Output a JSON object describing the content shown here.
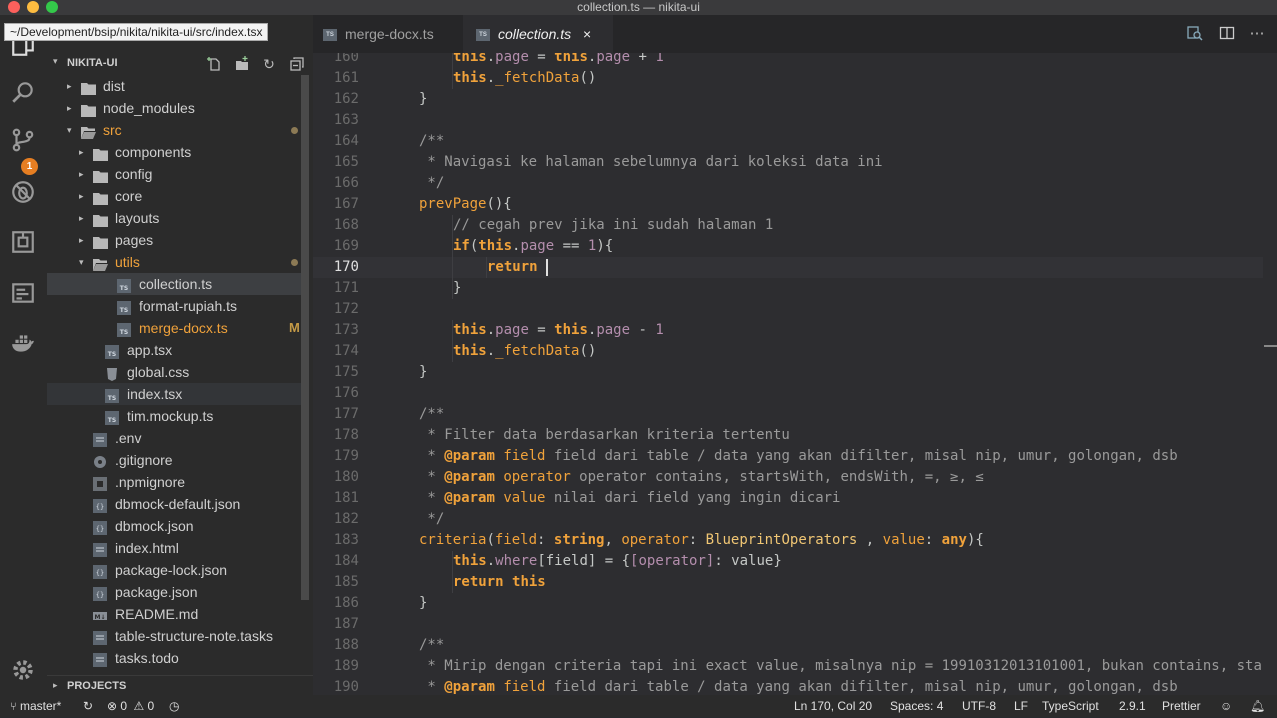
{
  "window": {
    "title": "collection.ts — nikita-ui"
  },
  "tooltip": "~/Development/bsip/nikita/nikita-ui/src/index.tsx",
  "activity": {
    "scm_badge": "1"
  },
  "sidebar": {
    "title": "NIKITA-UI",
    "tree": [
      {
        "label": "dist",
        "type": "folder",
        "depth": 0,
        "arrow": "▸"
      },
      {
        "label": "node_modules",
        "type": "folder",
        "depth": 0,
        "arrow": "▸"
      },
      {
        "label": "src",
        "type": "folder-open",
        "depth": 0,
        "arrow": "▾",
        "dot": true,
        "color": "#f0a23b"
      },
      {
        "label": "components",
        "type": "folder",
        "depth": 1,
        "arrow": "▸"
      },
      {
        "label": "config",
        "type": "folder",
        "depth": 1,
        "arrow": "▸"
      },
      {
        "label": "core",
        "type": "folder",
        "depth": 1,
        "arrow": "▸"
      },
      {
        "label": "layouts",
        "type": "folder",
        "depth": 1,
        "arrow": "▸"
      },
      {
        "label": "pages",
        "type": "folder",
        "depth": 1,
        "arrow": "▸"
      },
      {
        "label": "utils",
        "type": "folder-open",
        "depth": 1,
        "arrow": "▾",
        "dot": true,
        "color": "#f0a23b"
      },
      {
        "label": "collection.ts",
        "type": "ts",
        "depth": 2,
        "selected": true
      },
      {
        "label": "format-rupiah.ts",
        "type": "ts",
        "depth": 2
      },
      {
        "label": "merge-docx.ts",
        "type": "ts",
        "depth": 2,
        "flag": "M",
        "color": "#f0a23b"
      },
      {
        "label": "app.tsx",
        "type": "ts",
        "depth": 1
      },
      {
        "label": "global.css",
        "type": "css",
        "depth": 1
      },
      {
        "label": "index.tsx",
        "type": "ts",
        "depth": 1,
        "hover": true
      },
      {
        "label": "tim.mockup.ts",
        "type": "ts",
        "depth": 1
      },
      {
        "label": ".env",
        "type": "file",
        "depth": 0
      },
      {
        "label": ".gitignore",
        "type": "git",
        "depth": 0
      },
      {
        "label": ".npmignore",
        "type": "npm",
        "depth": 0
      },
      {
        "label": "dbmock-default.json",
        "type": "json",
        "depth": 0
      },
      {
        "label": "dbmock.json",
        "type": "json",
        "depth": 0
      },
      {
        "label": "index.html",
        "type": "file",
        "depth": 0
      },
      {
        "label": "package-lock.json",
        "type": "json",
        "depth": 0
      },
      {
        "label": "package.json",
        "type": "json",
        "depth": 0
      },
      {
        "label": "README.md",
        "type": "md",
        "depth": 0
      },
      {
        "label": "table-structure-note.tasks",
        "type": "file",
        "depth": 0
      },
      {
        "label": "tasks.todo",
        "type": "file",
        "depth": 0
      }
    ],
    "projects_label": "PROJECTS"
  },
  "tabs": [
    {
      "label": "merge-docx.ts",
      "active": false
    },
    {
      "label": "collection.ts",
      "active": true,
      "close": "×"
    }
  ],
  "code": {
    "current_line": 170,
    "lines": [
      {
        "n": "160",
        "indent": 2,
        "t": [
          [
            "kw",
            "this"
          ],
          [
            "",
            "."
          ],
          [
            "pr",
            "page"
          ],
          [
            "",
            " = "
          ],
          [
            "kw",
            "this"
          ],
          [
            "",
            "."
          ],
          [
            "pr",
            "page"
          ],
          [
            "",
            " + "
          ],
          [
            "num",
            "1"
          ]
        ]
      },
      {
        "n": "161",
        "indent": 2,
        "t": [
          [
            "kw",
            "this"
          ],
          [
            "",
            "."
          ],
          [
            "fn",
            "_fetchData"
          ],
          [
            "",
            "()"
          ]
        ]
      },
      {
        "n": "162",
        "indent": 1,
        "t": [
          [
            "",
            "}"
          ]
        ]
      },
      {
        "n": "163",
        "indent": 0,
        "t": []
      },
      {
        "n": "164",
        "indent": 1,
        "t": [
          [
            "cm",
            "/**"
          ]
        ]
      },
      {
        "n": "165",
        "indent": 1,
        "t": [
          [
            "cm",
            " * Navigasi ke halaman sebelumnya dari koleksi data ini"
          ]
        ]
      },
      {
        "n": "166",
        "indent": 1,
        "t": [
          [
            "cm",
            " */"
          ]
        ]
      },
      {
        "n": "167",
        "indent": 1,
        "t": [
          [
            "fn",
            "prevPage"
          ],
          [
            "",
            "(){"
          ]
        ]
      },
      {
        "n": "168",
        "indent": 2,
        "t": [
          [
            "cm",
            "// cegah prev jika ini sudah halaman 1"
          ]
        ]
      },
      {
        "n": "169",
        "indent": 2,
        "t": [
          [
            "kw",
            "if"
          ],
          [
            "",
            "("
          ],
          [
            "kw",
            "this"
          ],
          [
            "",
            "."
          ],
          [
            "pr",
            "page"
          ],
          [
            "",
            " == "
          ],
          [
            "num",
            "1"
          ],
          [
            "",
            "){"
          ]
        ]
      },
      {
        "n": "170",
        "indent": 3,
        "t": [
          [
            "kw",
            "return"
          ],
          [
            "",
            " "
          ]
        ]
      },
      {
        "n": "171",
        "indent": 2,
        "t": [
          [
            "",
            "}"
          ]
        ]
      },
      {
        "n": "172",
        "indent": 0,
        "t": []
      },
      {
        "n": "173",
        "indent": 2,
        "t": [
          [
            "kw",
            "this"
          ],
          [
            "",
            "."
          ],
          [
            "pr",
            "page"
          ],
          [
            "",
            " = "
          ],
          [
            "kw",
            "this"
          ],
          [
            "",
            "."
          ],
          [
            "pr",
            "page"
          ],
          [
            "",
            " - "
          ],
          [
            "num",
            "1"
          ]
        ]
      },
      {
        "n": "174",
        "indent": 2,
        "t": [
          [
            "kw",
            "this"
          ],
          [
            "",
            "."
          ],
          [
            "fn",
            "_fetchData"
          ],
          [
            "",
            "()"
          ]
        ]
      },
      {
        "n": "175",
        "indent": 1,
        "t": [
          [
            "",
            "}"
          ]
        ]
      },
      {
        "n": "176",
        "indent": 0,
        "t": []
      },
      {
        "n": "177",
        "indent": 1,
        "t": [
          [
            "cm",
            "/**"
          ]
        ]
      },
      {
        "n": "178",
        "indent": 1,
        "t": [
          [
            "cm",
            " * Filter data berdasarkan kriteria tertentu"
          ]
        ]
      },
      {
        "n": "179",
        "indent": 1,
        "t": [
          [
            "cm",
            " * "
          ],
          [
            "kw",
            "@param"
          ],
          [
            "",
            " "
          ],
          [
            "pa",
            "field"
          ],
          [
            "cm",
            " field dari table / data yang akan difilter, misal nip, umur, golongan, dsb"
          ]
        ]
      },
      {
        "n": "180",
        "indent": 1,
        "t": [
          [
            "cm",
            " * "
          ],
          [
            "kw",
            "@param"
          ],
          [
            "",
            " "
          ],
          [
            "pa",
            "operator"
          ],
          [
            "cm",
            " operator contains, startsWith, endsWith, =, ≥, ≤"
          ]
        ]
      },
      {
        "n": "181",
        "indent": 1,
        "t": [
          [
            "cm",
            " * "
          ],
          [
            "kw",
            "@param"
          ],
          [
            "",
            " "
          ],
          [
            "pa",
            "value"
          ],
          [
            "cm",
            " nilai dari field yang ingin dicari"
          ]
        ]
      },
      {
        "n": "182",
        "indent": 1,
        "t": [
          [
            "cm",
            " */"
          ]
        ]
      },
      {
        "n": "183",
        "indent": 1,
        "t": [
          [
            "fn",
            "criteria"
          ],
          [
            "",
            "("
          ],
          [
            "pa",
            "field"
          ],
          [
            "",
            ": "
          ],
          [
            "kw",
            "string"
          ],
          [
            "",
            ", "
          ],
          [
            "pa",
            "operator"
          ],
          [
            "",
            ": "
          ],
          [
            "ty",
            "BlueprintOperators"
          ],
          [
            "",
            " , "
          ],
          [
            "pa",
            "value"
          ],
          [
            "",
            ": "
          ],
          [
            "kw",
            "any"
          ],
          [
            "",
            "){"
          ]
        ]
      },
      {
        "n": "184",
        "indent": 2,
        "t": [
          [
            "kw",
            "this"
          ],
          [
            "",
            "."
          ],
          [
            "pr",
            "where"
          ],
          [
            "",
            "[field] = {"
          ],
          [
            "pr",
            "[operator]"
          ],
          [
            "",
            ": value}"
          ]
        ]
      },
      {
        "n": "185",
        "indent": 2,
        "t": [
          [
            "kw",
            "return"
          ],
          [
            "",
            " "
          ],
          [
            "kw",
            "this"
          ]
        ]
      },
      {
        "n": "186",
        "indent": 1,
        "t": [
          [
            "",
            "}"
          ]
        ]
      },
      {
        "n": "187",
        "indent": 0,
        "t": []
      },
      {
        "n": "188",
        "indent": 1,
        "t": [
          [
            "cm",
            "/**"
          ]
        ]
      },
      {
        "n": "189",
        "indent": 1,
        "t": [
          [
            "cm",
            " * Mirip dengan criteria tapi ini exact value, misalnya nip = 19910312013101001, bukan contains, starts"
          ]
        ]
      },
      {
        "n": "190",
        "indent": 1,
        "t": [
          [
            "cm",
            " * "
          ],
          [
            "kw",
            "@param"
          ],
          [
            "",
            " "
          ],
          [
            "pa",
            "field"
          ],
          [
            "cm",
            " field dari table / data yang akan difilter, misal nip, umur, golongan, dsb"
          ]
        ]
      }
    ]
  },
  "status": {
    "branch": "master*",
    "errors": "0",
    "warnings": "0",
    "position": "Ln 170, Col 20",
    "spaces": "Spaces: 4",
    "encoding": "UTF-8",
    "eol": "LF",
    "language": "TypeScript",
    "version": "2.9.1",
    "formatter": "Prettier"
  }
}
